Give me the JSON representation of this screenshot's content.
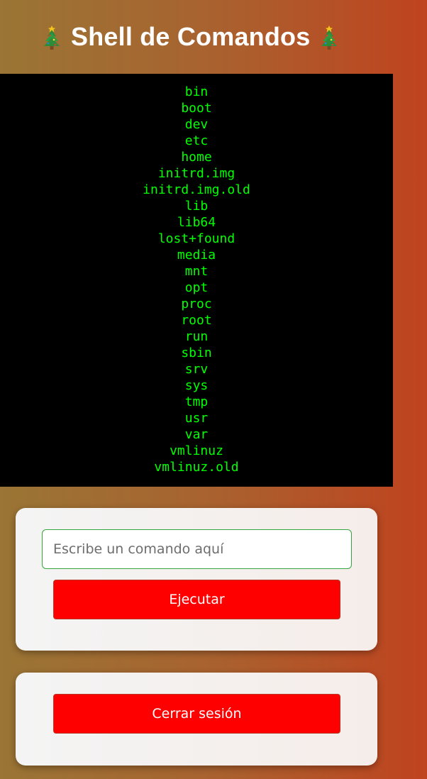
{
  "header": {
    "title": "Shell de Comandos",
    "icon_left": "christmas-tree-icon",
    "icon_right": "christmas-tree-icon"
  },
  "terminal": {
    "output_lines": [
      "bin",
      "boot",
      "dev",
      "etc",
      "home",
      "initrd.img",
      "initrd.img.old",
      "lib",
      "lib64",
      "lost+found",
      "media",
      "mnt",
      "opt",
      "proc",
      "root",
      "run",
      "sbin",
      "srv",
      "sys",
      "tmp",
      "usr",
      "var",
      "vmlinuz",
      "vmlinuz.old"
    ],
    "text_color": "#00ff00",
    "background": "#000000"
  },
  "command_form": {
    "input_value": "",
    "input_placeholder": "Escribe un comando aquí",
    "submit_label": "Ejecutar"
  },
  "logout": {
    "button_label": "Cerrar sesión"
  },
  "colors": {
    "button": "#ff0000",
    "input_border": "#39a53f",
    "card_bg": "#f4f1ef"
  }
}
